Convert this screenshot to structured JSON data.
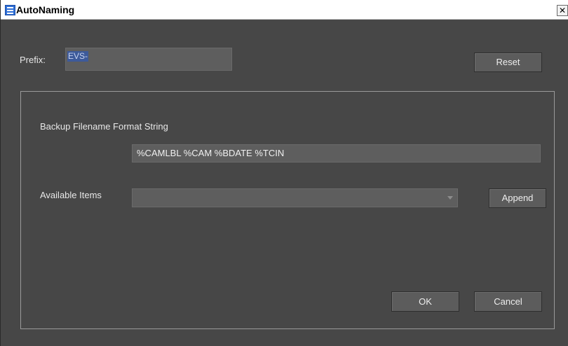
{
  "window": {
    "title": "AutoNaming",
    "close_glyph": "✕",
    "icon": "app-menu-icon"
  },
  "prefix": {
    "label": "Prefix:",
    "value": "EVS-",
    "reset_label": "Reset"
  },
  "format": {
    "label": "Backup Filename Format String",
    "value": "%CAMLBL %CAM %BDATE %TCIN"
  },
  "available": {
    "label": "Available Items",
    "selected": "",
    "append_label": "Append"
  },
  "footer": {
    "ok_label": "OK",
    "cancel_label": "Cancel"
  },
  "colors": {
    "background": "#474747",
    "field": "#5e5e5e",
    "button": "#5c5c5c",
    "selection": "#3d5a9a"
  }
}
